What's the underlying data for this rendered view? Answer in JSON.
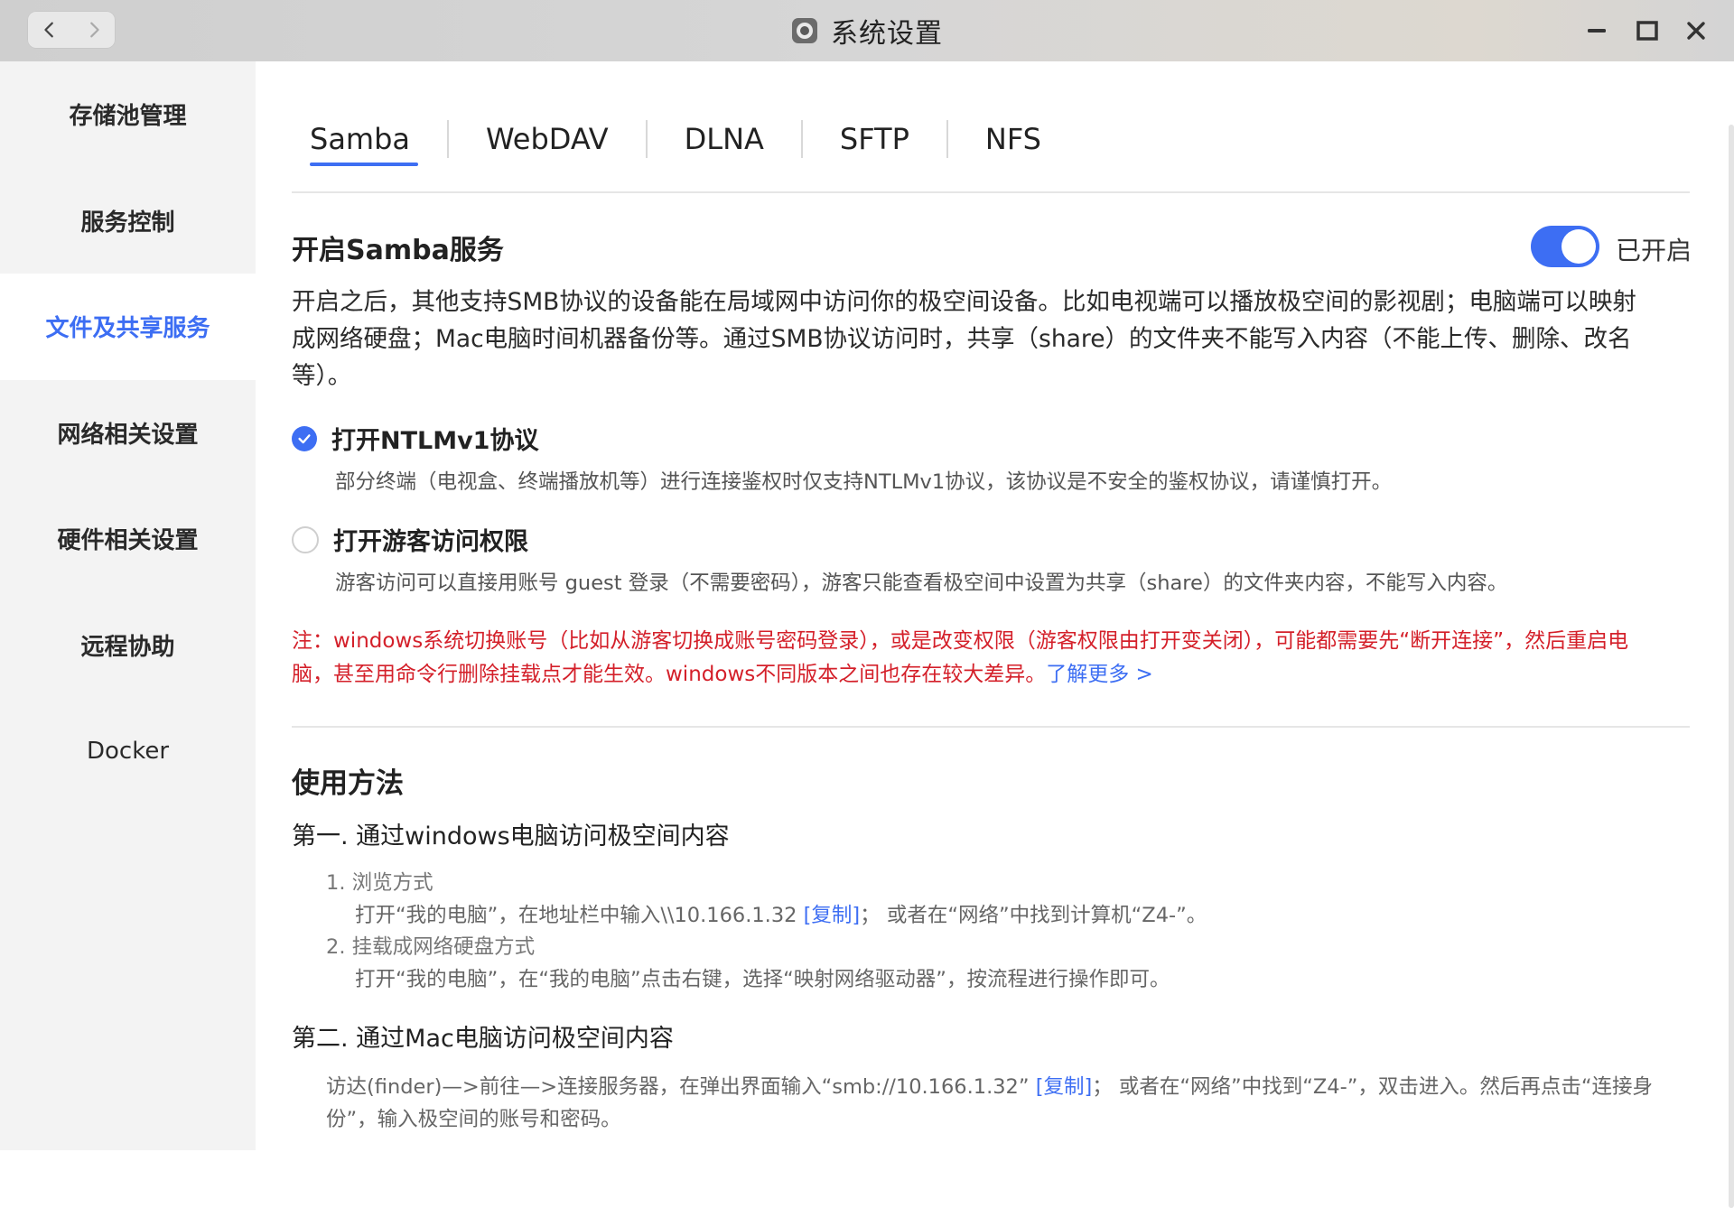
{
  "window": {
    "title": "系统设置"
  },
  "sidebar": {
    "items": [
      {
        "label": "存储池管理"
      },
      {
        "label": "服务控制"
      },
      {
        "label": "文件及共享服务"
      },
      {
        "label": "网络相关设置"
      },
      {
        "label": "硬件相关设置"
      },
      {
        "label": "远程协助"
      },
      {
        "label": "Docker"
      }
    ],
    "active": "文件及共享服务"
  },
  "tabs": [
    "Samba",
    "WebDAV",
    "DLNA",
    "SFTP",
    "NFS"
  ],
  "active_tab": "Samba",
  "samba": {
    "title": "开启Samba服务",
    "toggle_state": "已开启",
    "toggle_on": true,
    "desc_lines": [
      "开启之后，其他支持SMB协议的设备能在局域网中访问你的极空间设备。比如电视端可以播放极空间的影视剧；电脑端可以映射",
      "成网络硬盘；Mac电脑时间机器备份等。通过SMB协议访问时，共享（share）的文件夹不能写入内容（不能上传、删除、改名",
      "等）。"
    ],
    "ntlm": {
      "label": "打开NTLMv1协议",
      "checked": true,
      "desc": "部分终端（电视盒、终端播放机等）进行连接鉴权时仅支持NTLMv1协议，该协议是不安全的鉴权协议，请谨慎打开。"
    },
    "guest": {
      "label": "打开游客访问权限",
      "checked": false,
      "desc": "游客访问可以直接用账号 guest 登录（不需要密码），游客只能查看极空间中设置为共享（share）的文件夹内容，不能写入内容。"
    },
    "note_line1": "注：windows系统切换账号（比如从游客切换成账号密码登录），或是改变权限（游客权限由打开变关闭），可能都需要先“断开连接”，然后重启电",
    "note_line2": "脑，甚至用命令行删除挂载点才能生效。windows不同版本之间也存在较大差异。",
    "learn_more": "了解更多 >"
  },
  "usage": {
    "title": "使用方法",
    "windows": {
      "title": "第一. 通过windows电脑访问极空间内容",
      "step1_title": "1. 浏览方式",
      "step1_a": "打开“我的电脑”，在地址栏中输入\\\\10.166.1.32",
      "copy": "[复制]",
      "step1_b": "；  或者在“网络”中找到计算机“Z4-”。",
      "step2_title": "2. 挂载成网络硬盘方式",
      "step2_desc": "打开“我的电脑”，在“我的电脑”点击右键，选择“映射网络驱动器”，按流程进行操作即可。"
    },
    "mac": {
      "title": "第二. 通过Mac电脑访问极空间内容",
      "line1_a": "访达(finder)—>前往—>连接服务器，在弹出界面输入“smb://10.166.1.32”",
      "copy": "[复制]",
      "line1_b": "；  或者在“网络”中找到“Z4-”，双击进入。然后再点击“连接身",
      "line2": "份”，输入极空间的账号和密码。"
    }
  },
  "colors": {
    "accent": "#3d6ef3",
    "warning": "#d4202a",
    "sidebar_bg": "#f3f3f3"
  }
}
